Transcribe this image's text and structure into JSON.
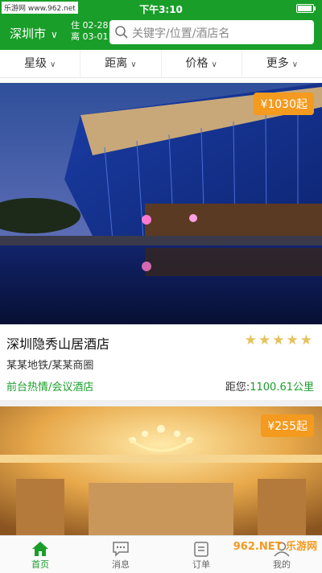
{
  "status": {
    "watermark": "乐游网 www.962.net",
    "time": "下午3:10"
  },
  "header": {
    "city": "深圳市",
    "checkin": "住 02-28",
    "checkout": "离 03-01",
    "search_placeholder": "关键字/位置/酒店名"
  },
  "filters": [
    {
      "label": "星级"
    },
    {
      "label": "距离"
    },
    {
      "label": "价格"
    },
    {
      "label": "更多"
    }
  ],
  "hotels": [
    {
      "price": "¥1030起",
      "name": "深圳隐秀山居酒店",
      "stars": "★★★★★",
      "area": "某某地铁/某某商圈",
      "tags": "前台热情/会议酒店",
      "distance_label": "距您:",
      "distance_value": "1100.61公里"
    },
    {
      "price": "¥255起"
    }
  ],
  "tabbar": [
    {
      "label": "首页",
      "icon": "home-icon"
    },
    {
      "label": "消息",
      "icon": "message-icon"
    },
    {
      "label": "订单",
      "icon": "order-icon"
    },
    {
      "label": "我的",
      "icon": "user-icon"
    }
  ],
  "watermark_br": "962.NET 乐游网",
  "colors": {
    "brand": "#1a9e2a",
    "price": "#f39a1f",
    "star": "#e6c25a"
  }
}
